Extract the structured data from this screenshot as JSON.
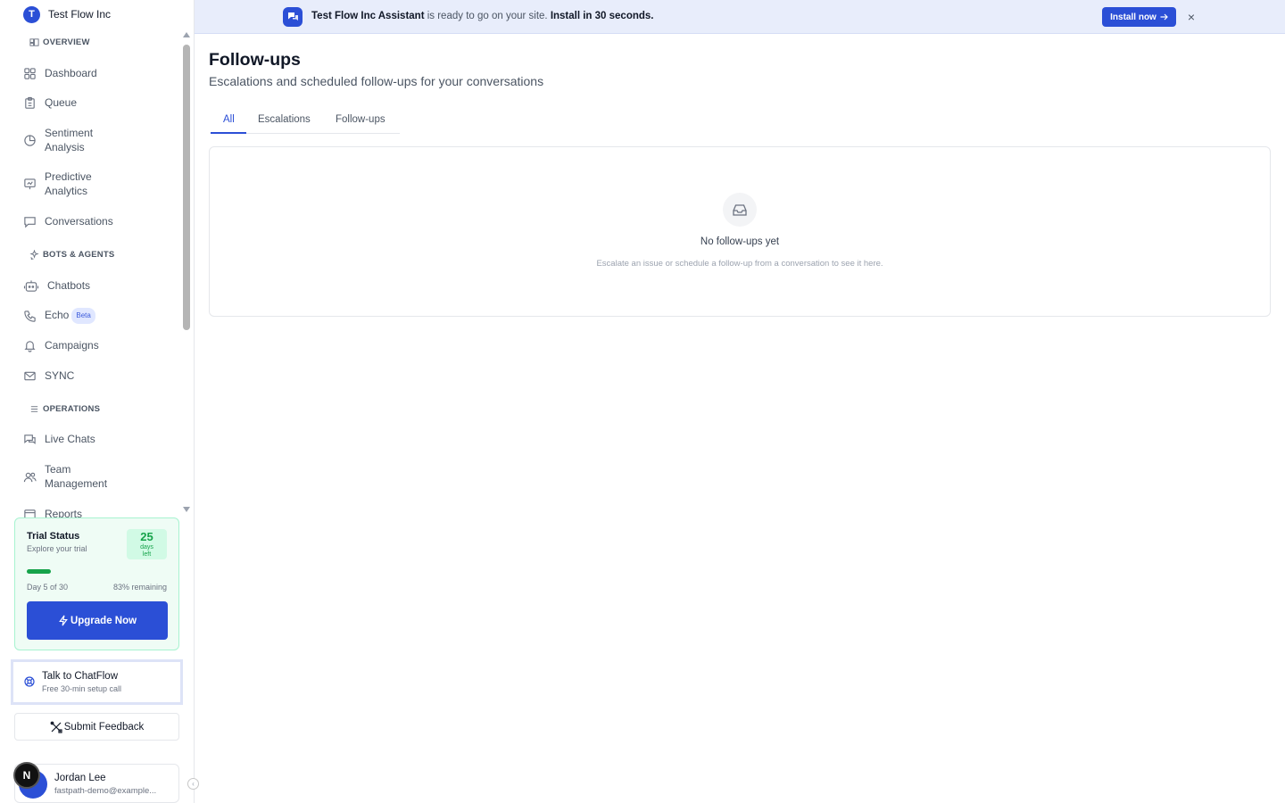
{
  "brand": {
    "initial": "T",
    "name": "Test Flow Inc"
  },
  "sections": {
    "overview": "OVERVIEW",
    "bots": "BOTS & AGENTS",
    "operations": "OPERATIONS"
  },
  "nav": {
    "dashboard": "Dashboard",
    "queue": "Queue",
    "sentiment_1": "Sentiment",
    "sentiment_2": "Analysis",
    "predictive_1": "Predictive",
    "predictive_2": "Analytics",
    "conversations": "Conversations",
    "chatbots": "Chatbots",
    "echo": "Echo",
    "echo_badge": "Beta",
    "campaigns": "Campaigns",
    "sync": "SYNC",
    "live_chats": "Live Chats",
    "team_1": "Team",
    "team_2": "Management",
    "reports": "Reports"
  },
  "trial": {
    "title": "Trial Status",
    "subtitle": "Explore your trial",
    "days_number": "25",
    "days_label": "days left",
    "day_text": "Day 5 of 30",
    "remaining_text": "83% remaining",
    "progress_fraction": 0.17,
    "upgrade_label": "Upgrade Now"
  },
  "talk": {
    "title": "Talk to ChatFlow",
    "subtitle": "Free 30-min setup call"
  },
  "feedback_label": "Submit Feedback",
  "user": {
    "name": "Jordan Lee",
    "email": "fastpath-demo@example...",
    "badge": "N"
  },
  "banner": {
    "assistant_name": "Test Flow Inc Assistant",
    "message": " is ready to go on your site. ",
    "cta_text": "Install in 30 seconds.",
    "install_label": "Install now",
    "close_glyph": "×"
  },
  "main": {
    "title": "Follow-ups",
    "subtitle": "Escalations and scheduled follow-ups for your conversations",
    "tabs": [
      "All",
      "Escalations",
      "Follow-ups"
    ],
    "empty_title": "No follow-ups yet",
    "empty_subtitle": "Escalate an issue or schedule a follow-up from a conversation to see it here."
  },
  "colors": {
    "accent": "#2b4fd6",
    "trial_green": "#16a34a",
    "banner_bg": "#e8edfb"
  },
  "icons": {
    "brand": "brand-avatar",
    "overview": "layout-icon",
    "dashboard": "grid-icon",
    "queue": "clipboard-icon",
    "sentiment": "pie-chart-icon",
    "predictive": "presentation-icon",
    "conversations": "message-icon",
    "bots": "sparkles-icon",
    "chatbots": "bot-icon",
    "echo": "phone-icon",
    "campaigns": "bell-icon",
    "sync": "mail-icon",
    "operations": "list-icon",
    "live_chats": "chats-icon",
    "team": "users-icon",
    "reports": "report-icon",
    "upgrade": "bolt-icon",
    "talk": "lifebuoy-icon",
    "feedback": "tools-icon",
    "banner": "chat-bubbles-icon",
    "install": "arrow-right-icon",
    "empty": "inbox-icon"
  }
}
